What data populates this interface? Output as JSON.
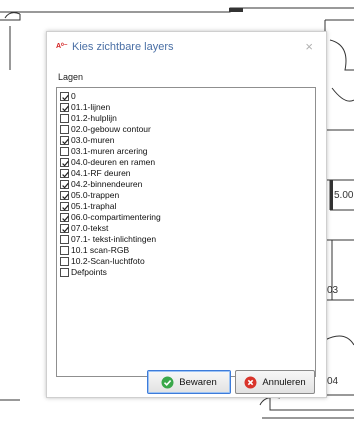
{
  "background": {
    "labels": [
      "5.00",
      "03",
      "04"
    ]
  },
  "dialog": {
    "title": "Kies zichtbare layers",
    "app_icon_text": "A⁰⁻",
    "close_symbol": "×",
    "group_label": "Lagen",
    "layers": [
      {
        "name": "0",
        "checked": true
      },
      {
        "name": "01.1-lijnen",
        "checked": true
      },
      {
        "name": "01.2-hulplijn",
        "checked": false
      },
      {
        "name": "02.0-gebouw contour",
        "checked": false
      },
      {
        "name": "03.0-muren",
        "checked": true
      },
      {
        "name": "03.1-muren arcering",
        "checked": false
      },
      {
        "name": "04.0-deuren en ramen",
        "checked": true
      },
      {
        "name": "04.1-RF deuren",
        "checked": true
      },
      {
        "name": "04.2-binnendeuren",
        "checked": true
      },
      {
        "name": "05.0-trappen",
        "checked": true
      },
      {
        "name": "05.1-traphal",
        "checked": true
      },
      {
        "name": "06.0-compartimentering",
        "checked": true
      },
      {
        "name": "07.0-tekst",
        "checked": true
      },
      {
        "name": "07.1- tekst-inlichtingen",
        "checked": false
      },
      {
        "name": "10.1 scan-RGB",
        "checked": false
      },
      {
        "name": "10.2-Scan-luchtfoto",
        "checked": false
      },
      {
        "name": "Defpoints",
        "checked": false
      }
    ],
    "buttons": {
      "save": "Bewaren",
      "cancel": "Annuleren"
    }
  },
  "colors": {
    "title": "#4a6fa5",
    "save_icon": "#3aa84a",
    "cancel_icon": "#d9342b"
  }
}
